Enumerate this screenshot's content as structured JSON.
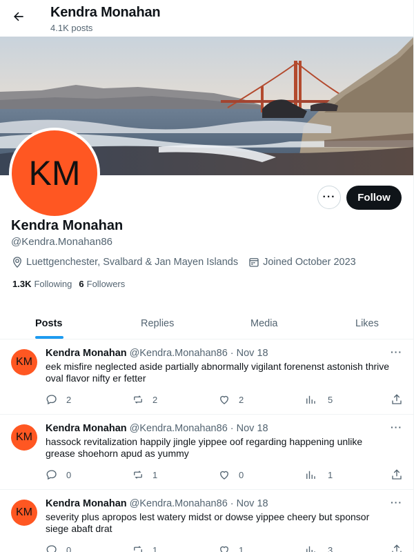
{
  "header": {
    "title": "Kendra Monahan",
    "subtitle": "4.1K posts"
  },
  "profile": {
    "initials": "KM",
    "name": "Kendra Monahan",
    "handle": "@Kendra.Monahan86",
    "location": "Luettgenchester, Svalbard & Jan Mayen Islands",
    "joined": "Joined October 2023",
    "following_count": "1.3K",
    "following_label": "Following",
    "followers_count": "6",
    "followers_label": "Followers",
    "follow_label": "Follow",
    "more_label": "···",
    "avatar_color": "#ff5722"
  },
  "tabs": [
    "Posts",
    "Replies",
    "Media",
    "Likes"
  ],
  "active_tab": "Posts",
  "posts": [
    {
      "initials": "KM",
      "name": "Kendra Monahan",
      "handle": "@Kendra.Monahan86 · Nov 18",
      "text": "eek misfire neglected aside partially abnormally vigilant forenenst astonish thrive oval flavor nifty er fetter",
      "replies": "2",
      "reposts": "2",
      "likes": "2",
      "views": "5"
    },
    {
      "initials": "KM",
      "name": "Kendra Monahan",
      "handle": "@Kendra.Monahan86 · Nov 18",
      "text": "hassock revitalization happily jingle yippee oof regarding happening unlike grease shoehorn apud as yummy",
      "replies": "0",
      "reposts": "1",
      "likes": "0",
      "views": "1"
    },
    {
      "initials": "KM",
      "name": "Kendra Monahan",
      "handle": "@Kendra.Monahan86 · Nov 18",
      "text": "severity plus apropos lest watery midst or dowse yippee cheery but sponsor siege abaft drat",
      "replies": "0",
      "reposts": "1",
      "likes": "1",
      "views": "3"
    }
  ],
  "icons": {
    "back": "arrow-left-icon",
    "location": "location-pin-icon",
    "calendar": "calendar-icon",
    "reply": "reply-icon",
    "repost": "repost-icon",
    "like": "heart-icon",
    "views": "views-icon",
    "share": "share-icon"
  },
  "colors": {
    "accent": "#1d9bf0",
    "text": "#0f1419",
    "muted": "#536471",
    "button": "#0f1419"
  }
}
